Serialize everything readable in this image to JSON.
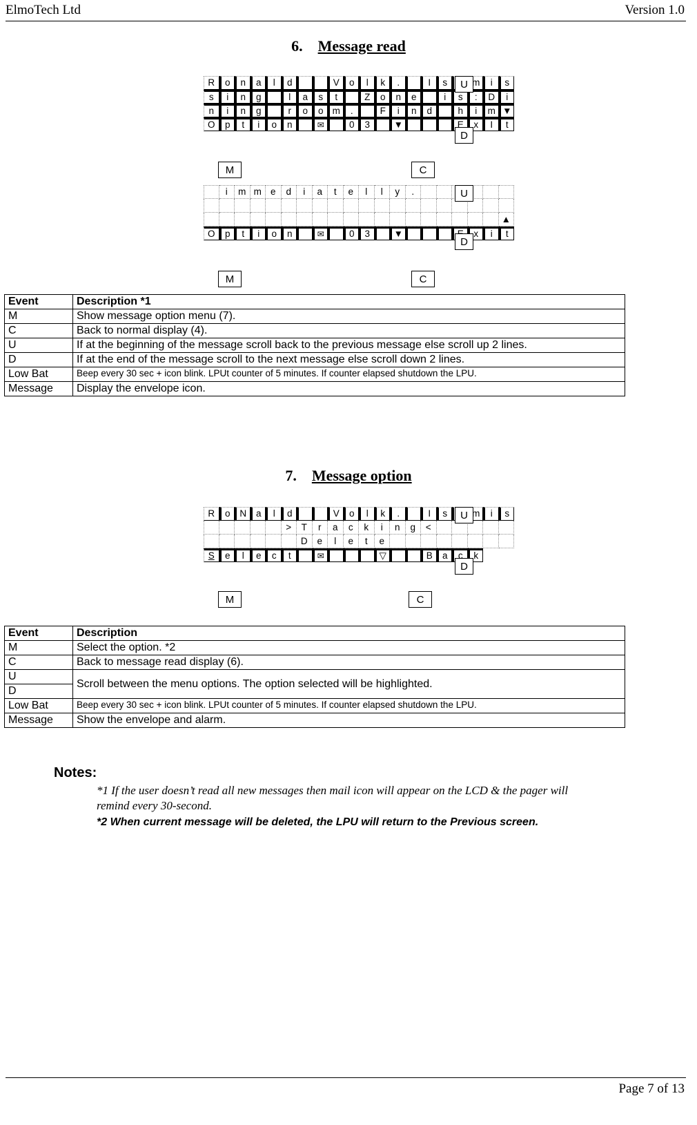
{
  "header": {
    "left": "ElmoTech Ltd",
    "right": "Version 1.0"
  },
  "footer": {
    "right": "Page 7 of 13"
  },
  "sections": [
    {
      "number": "6.",
      "title": "Message read"
    },
    {
      "number": "7.",
      "title": "Message option"
    }
  ],
  "lcd1": {
    "rows": [
      [
        "R",
        "o",
        "n",
        "a",
        "l",
        "d",
        " ",
        " ",
        "V",
        "o",
        "l",
        "k",
        ".",
        "  ",
        "I",
        "s",
        " ",
        "m",
        "i",
        "s"
      ],
      [
        "s",
        "i",
        "n",
        "g",
        " ",
        " ",
        "l",
        "a",
        "s",
        "t",
        " ",
        " ",
        "Z",
        "o",
        "n",
        "e",
        " ",
        "i",
        "s",
        ":",
        "D",
        "i"
      ],
      [
        "n",
        "i",
        "n",
        "g",
        " ",
        "r",
        "o",
        "o",
        "m",
        ".",
        "  ",
        "F",
        "i",
        "n",
        "d",
        " ",
        "h",
        "i",
        "m",
        "▼"
      ],
      [
        "O",
        "p",
        "t",
        "i",
        "o",
        "n",
        " ",
        "✉",
        " ",
        "0",
        "3",
        " ",
        "▼",
        " ",
        " ",
        " ",
        "E",
        "x",
        "I",
        "t"
      ]
    ],
    "keys": {
      "up": "U",
      "down": "D",
      "m": "M",
      "c": "C"
    }
  },
  "lcd2": {
    "rows": [
      [
        " ",
        "i",
        "m",
        "m",
        "e",
        "d",
        "i",
        "a",
        "t",
        "e",
        "l",
        "l",
        "y",
        ".",
        "",
        "",
        "",
        "",
        "",
        ""
      ],
      [
        "",
        "",
        "",
        "",
        "",
        "",
        "",
        "",
        "",
        "",
        "",
        "",
        "",
        "",
        "",
        "",
        "",
        "",
        "",
        "▲"
      ],
      [
        "O",
        "p",
        "t",
        "i",
        "o",
        "n",
        " ",
        "✉",
        " ",
        "0",
        "3",
        " ",
        "▼",
        " ",
        " ",
        " ",
        "E",
        "x",
        "i",
        "t"
      ]
    ],
    "keys": {
      "up": "U",
      "down": "D",
      "m": "M",
      "c": "C"
    }
  },
  "lcd3": {
    "rows": [
      [
        "R",
        "o",
        "N",
        "a",
        "l",
        "d",
        " ",
        " ",
        "V",
        "o",
        "l",
        "k",
        ".",
        "  ",
        "I",
        "s",
        " ",
        "m",
        "i",
        "s"
      ],
      [
        "",
        "",
        "",
        "",
        "",
        ">",
        "T",
        "r",
        "a",
        "c",
        "k",
        "i",
        "n",
        "g",
        "<",
        "",
        "",
        "",
        "",
        ""
      ],
      [
        "",
        "",
        "",
        "",
        "",
        "",
        "D",
        "e",
        "l",
        "e",
        "t",
        "e",
        "",
        "",
        "",
        "",
        "",
        "",
        "",
        ""
      ],
      [
        "S",
        "e",
        "l",
        "e",
        "c",
        "t",
        " ",
        "✉",
        " ",
        " ",
        " ",
        "▽",
        " ",
        " ",
        "B",
        "a",
        "c",
        "k"
      ]
    ],
    "keys": {
      "up": "U",
      "down": "D",
      "m": "M",
      "c": "C"
    }
  },
  "table1": {
    "headers": [
      "Event",
      "Description  *1"
    ],
    "rows": [
      [
        "M",
        "Show message option menu (7)."
      ],
      [
        "C",
        "Back to normal display (4)."
      ],
      [
        "U",
        "If at the beginning of the message scroll back to the previous message else scroll up 2 lines."
      ],
      [
        "D",
        "If at the end of the message scroll to the next message else scroll down 2 lines."
      ],
      [
        "Low Bat",
        "Beep every 30 sec + icon blink. LPUt counter of 5 minutes. If counter elapsed shutdown the LPU."
      ],
      [
        "Message",
        "Display the envelope icon."
      ]
    ]
  },
  "table2": {
    "headers": [
      "Event",
      "Description"
    ],
    "rows": [
      [
        "M",
        "Select the option. *2"
      ],
      [
        "C",
        "Back to message read display (6)."
      ],
      [
        "U",
        "Scroll between the menu options. The option selected will be highlighted."
      ],
      [
        "D",
        ""
      ],
      [
        "Low Bat",
        "Beep every 30 sec + icon blink. LPUt counter of 5 minutes. If counter elapsed shutdown the LPU."
      ],
      [
        "Message",
        "Show the envelope and alarm."
      ]
    ],
    "merged_ud_text": "Scroll between the menu options. The option selected will be highlighted."
  },
  "notes": {
    "title": "Notes:",
    "note1_line1": "*1 If the user doesn’t read all new messages then mail icon will appear on the LCD & the pager will",
    "note1_line2": "remind every 30-second.",
    "note2": "*2 When current message will be deleted, the LPU will return to the Previous screen."
  }
}
